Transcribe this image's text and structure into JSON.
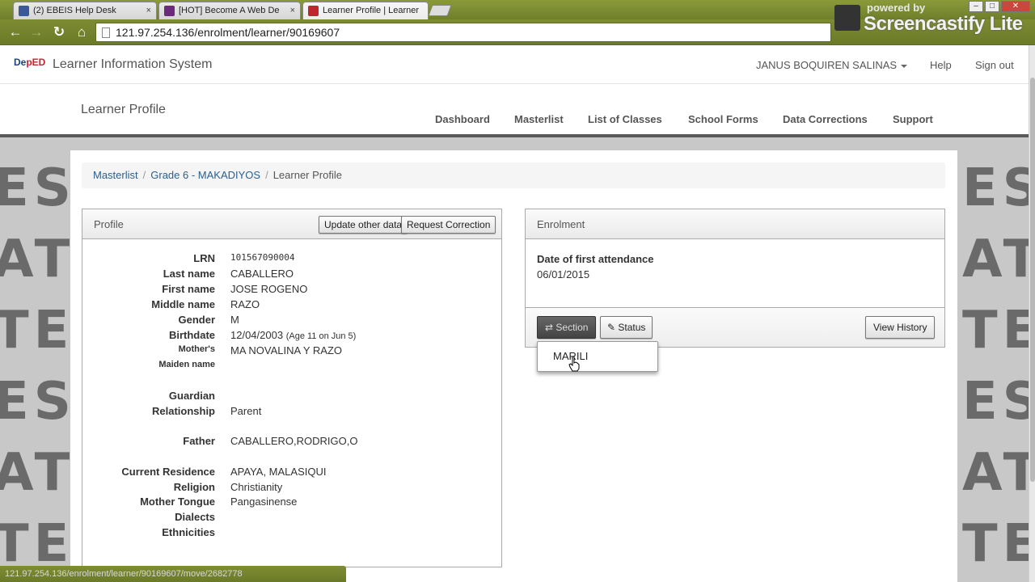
{
  "browser": {
    "tabs": [
      {
        "title": "(2) EBEIS Help Desk",
        "favicon_color": "#3b5998"
      },
      {
        "title": "[HOT] Become A Web De",
        "favicon_color": "#6b2a7a"
      },
      {
        "title": "Learner Profile | Learner",
        "favicon_color": "#c0262d"
      }
    ],
    "close_glyph": "×",
    "url": "121.97.254.136/enrolment/learner/90169607",
    "status_url": "121.97.254.136/enrolment/learner/90169607/move/2682778",
    "watermark_powered": "powered by",
    "watermark_brand": "Screencastify Lite"
  },
  "header": {
    "logo_a": "De",
    "logo_b": "pED",
    "app_title": "Learner Information System",
    "user": "JANUS BOQUIREN SALINAS",
    "help": "Help",
    "signout": "Sign out"
  },
  "subnav": {
    "title": "Learner Profile",
    "menu": [
      "Dashboard",
      "Masterlist",
      "List of Classes",
      "School Forms",
      "Data Corrections",
      "Support"
    ]
  },
  "background_words": [
    "EST",
    "ATE",
    "TES"
  ],
  "breadcrumb": {
    "items": [
      "Masterlist",
      "Grade 6 - MAKADIYOS",
      "Learner Profile"
    ],
    "separator": "/"
  },
  "profile": {
    "title": "Profile",
    "btn_update": "Update other data",
    "btn_request": "Request Correction",
    "rows": [
      {
        "label": "LRN",
        "value": "101567090004"
      },
      {
        "label": "Last name",
        "value": "CABALLERO"
      },
      {
        "label": "First name",
        "value": "JOSE ROGENO"
      },
      {
        "label": "Middle name",
        "value": "RAZO"
      },
      {
        "label": "Gender",
        "value": "M"
      },
      {
        "label": "Birthdate",
        "value": "12/04/2003",
        "note": "(Age 11 on Jun 5)"
      },
      {
        "label": "Mother's",
        "value": "MA NOVALINA Y RAZO"
      },
      {
        "label": "Maiden name",
        "value": ""
      },
      {
        "label": "Guardian",
        "value": ""
      },
      {
        "label": "Relationship",
        "value": "Parent"
      },
      {
        "label": "Father",
        "value": "CABALLERO,RODRIGO,O"
      },
      {
        "label": "Current Residence",
        "value": "APAYA, MALASIQUI"
      },
      {
        "label": "Religion",
        "value": "Christianity"
      },
      {
        "label": "Mother Tongue",
        "value": "Pangasinense"
      },
      {
        "label": "Dialects",
        "value": ""
      },
      {
        "label": "Ethnicities",
        "value": ""
      }
    ]
  },
  "enrolment": {
    "title": "Enrolment",
    "date_label": "Date of first attendance",
    "date_value": "06/01/2015",
    "btn_section": "⇄ Section",
    "btn_status": "✎ Status",
    "btn_history": "View History",
    "dropdown_item": "MARILI"
  }
}
